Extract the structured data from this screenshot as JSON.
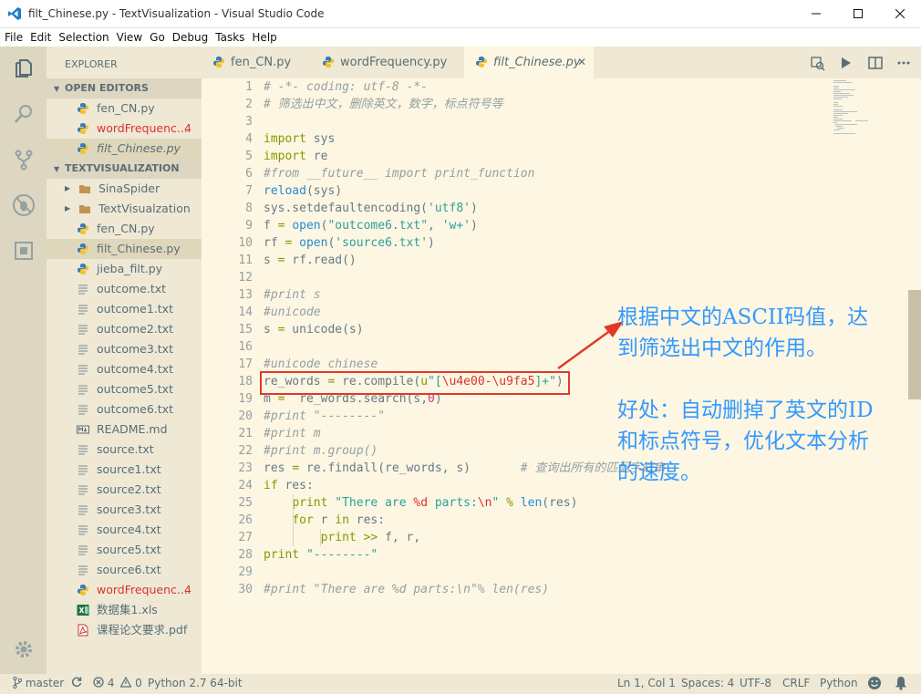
{
  "window": {
    "title": "filt_Chinese.py - TextVisualization - Visual Studio Code"
  },
  "menu": [
    "File",
    "Edit",
    "Selection",
    "View",
    "Go",
    "Debug",
    "Tasks",
    "Help"
  ],
  "sidebar": {
    "title": "EXPLORER",
    "open_editors_header": "OPEN EDITORS",
    "open_editors": [
      {
        "label": "fen_CN.py",
        "icon": "python-icon"
      },
      {
        "label": "wordFrequenc...",
        "badge": "4",
        "icon": "python-icon",
        "color": "#dc322f"
      },
      {
        "label": "filt_Chinese.py",
        "icon": "python-icon",
        "italic": true,
        "selected": true
      }
    ],
    "project_header": "TEXTVISUALIZATION",
    "files": [
      {
        "label": "SinaSpider",
        "icon": "folder-icon",
        "folder": true
      },
      {
        "label": "TextVisualzation",
        "icon": "folder-icon",
        "folder": true
      },
      {
        "label": "fen_CN.py",
        "icon": "python-icon"
      },
      {
        "label": "filt_Chinese.py",
        "icon": "python-icon",
        "selected": true
      },
      {
        "label": "jieba_filt.py",
        "icon": "python-icon"
      },
      {
        "label": "outcome.txt",
        "icon": "text-file-icon"
      },
      {
        "label": "outcome1.txt",
        "icon": "text-file-icon"
      },
      {
        "label": "outcome2.txt",
        "icon": "text-file-icon"
      },
      {
        "label": "outcome3.txt",
        "icon": "text-file-icon"
      },
      {
        "label": "outcome4.txt",
        "icon": "text-file-icon"
      },
      {
        "label": "outcome5.txt",
        "icon": "text-file-icon"
      },
      {
        "label": "outcome6.txt",
        "icon": "text-file-icon"
      },
      {
        "label": "README.md",
        "icon": "markdown-icon"
      },
      {
        "label": "source.txt",
        "icon": "text-file-icon"
      },
      {
        "label": "source1.txt",
        "icon": "text-file-icon"
      },
      {
        "label": "source2.txt",
        "icon": "text-file-icon"
      },
      {
        "label": "source3.txt",
        "icon": "text-file-icon"
      },
      {
        "label": "source4.txt",
        "icon": "text-file-icon"
      },
      {
        "label": "source5.txt",
        "icon": "text-file-icon"
      },
      {
        "label": "source6.txt",
        "icon": "text-file-icon"
      },
      {
        "label": "wordFrequenc...",
        "badge": "4",
        "icon": "python-icon",
        "color": "#dc322f"
      },
      {
        "label": "数据集1.xls",
        "icon": "excel-icon"
      },
      {
        "label": "课程论文要求.pdf",
        "icon": "pdf-icon"
      }
    ]
  },
  "tabs": [
    {
      "label": "fen_CN.py"
    },
    {
      "label": "wordFrequency.py"
    },
    {
      "label": "filt_Chinese.py",
      "active": true
    }
  ],
  "code_lines": [
    "1",
    "2",
    "3",
    "4",
    "5",
    "6",
    "7",
    "8",
    "9",
    "10",
    "11",
    "12",
    "13",
    "14",
    "15",
    "16",
    "17",
    "18",
    "19",
    "20",
    "21",
    "22",
    "23",
    "24",
    "25",
    "26",
    "27",
    "28",
    "29",
    "30"
  ],
  "code": [
    [
      [
        "# -*- coding: utf-8 -*-",
        "com"
      ]
    ],
    [
      [
        "# 筛选出中文，删除英文，数字，标点符号等",
        "com"
      ]
    ],
    [],
    [
      [
        "import",
        "kw"
      ],
      [
        " sys",
        "t"
      ]
    ],
    [
      [
        "import",
        "kw"
      ],
      [
        " re",
        "t"
      ]
    ],
    [
      [
        "#from __future__ import print_function",
        "com"
      ]
    ],
    [
      [
        "reload",
        "fn"
      ],
      [
        "(sys)",
        "t"
      ]
    ],
    [
      [
        "sys.setdefaultencoding(",
        "t"
      ],
      [
        "'utf8'",
        "str"
      ],
      [
        ")",
        "t"
      ]
    ],
    [
      [
        "f ",
        "t"
      ],
      [
        "=",
        "op"
      ],
      [
        " ",
        "t"
      ],
      [
        "open",
        "fn"
      ],
      [
        "(",
        "t"
      ],
      [
        "\"outcome6.txt\"",
        "str"
      ],
      [
        ", ",
        "t"
      ],
      [
        "'w+'",
        "str"
      ],
      [
        ")",
        "t"
      ]
    ],
    [
      [
        "rf ",
        "t"
      ],
      [
        "=",
        "op"
      ],
      [
        " ",
        "t"
      ],
      [
        "open",
        "fn"
      ],
      [
        "(",
        "t"
      ],
      [
        "'source6.txt'",
        "str"
      ],
      [
        ")",
        "t"
      ]
    ],
    [
      [
        "s ",
        "t"
      ],
      [
        "=",
        "op"
      ],
      [
        " rf.read()",
        "t"
      ]
    ],
    [],
    [
      [
        "#print s",
        "com"
      ]
    ],
    [
      [
        "#unicode",
        "com"
      ]
    ],
    [
      [
        "s ",
        "t"
      ],
      [
        "=",
        "op"
      ],
      [
        " unicode(s)",
        "t"
      ]
    ],
    [],
    [
      [
        "#unicode chinese",
        "com"
      ]
    ],
    [
      [
        "re_words ",
        "t"
      ],
      [
        "=",
        "op"
      ],
      [
        " re.compile(",
        "t"
      ],
      [
        "u",
        "kw"
      ],
      [
        "\"[",
        "str"
      ],
      [
        "\\u4e00-\\u9fa5",
        "esc"
      ],
      [
        "]+\"",
        "str"
      ],
      [
        ")",
        "t"
      ]
    ],
    [
      [
        "m ",
        "t"
      ],
      [
        "=",
        "op"
      ],
      [
        "  re_words.search(s,",
        "t"
      ],
      [
        "0",
        "num"
      ],
      [
        ")",
        "t"
      ]
    ],
    [
      [
        "#print \"--------\"",
        "com"
      ]
    ],
    [
      [
        "#print m",
        "com"
      ]
    ],
    [
      [
        "#print m.group()",
        "com"
      ]
    ],
    [
      [
        "res ",
        "t"
      ],
      [
        "=",
        "op"
      ],
      [
        " re.findall(re_words, s)       ",
        "t"
      ],
      [
        "# 查询出所有的匹配字符串",
        "com"
      ]
    ],
    [
      [
        "if",
        "kw"
      ],
      [
        " res:",
        "t"
      ]
    ],
    [
      [
        "    ",
        "t"
      ],
      [
        "print",
        "kw"
      ],
      [
        " ",
        "t"
      ],
      [
        "\"There are ",
        "str"
      ],
      [
        "%d",
        "esc"
      ],
      [
        " parts:",
        "str"
      ],
      [
        "\\n",
        "esc"
      ],
      [
        "\"",
        "str"
      ],
      [
        " ",
        "t"
      ],
      [
        "%",
        "op"
      ],
      [
        " ",
        "t"
      ],
      [
        "len",
        "fn"
      ],
      [
        "(res)",
        "t"
      ]
    ],
    [
      [
        "    ",
        "t"
      ],
      [
        "for",
        "kw"
      ],
      [
        " r ",
        "t"
      ],
      [
        "in",
        "kw"
      ],
      [
        " res:",
        "t"
      ]
    ],
    [
      [
        "        ",
        "t"
      ],
      [
        "print",
        "kw"
      ],
      [
        " ",
        "t"
      ],
      [
        ">>",
        "op"
      ],
      [
        " f, r,",
        "t"
      ]
    ],
    [
      [
        "print",
        "kw"
      ],
      [
        " ",
        "t"
      ],
      [
        "\"--------\"",
        "str"
      ]
    ],
    [],
    [
      [
        "#print \"There are %d parts:\\n\"% len(res)",
        "com"
      ]
    ]
  ],
  "annotation": {
    "line1": "根据中文的ASCII码值，达",
    "line2": "到筛选出中文的作用。",
    "line3": "好处：自动删掉了英文的ID",
    "line4": "和标点符号，优化文本分析",
    "line5": "的速度。"
  },
  "status": {
    "branch": "master",
    "errors": "4",
    "warnings": "0",
    "interpreter": "Python 2.7 64-bit",
    "cursor": "Ln 1, Col 1",
    "spaces": "Spaces: 4",
    "encoding": "UTF-8",
    "eol": "CRLF",
    "language": "Python"
  },
  "colors": {
    "keyword": "#859900",
    "string": "#2aa198",
    "comment": "#93a1a1",
    "function": "#268bd2",
    "escape": "#dc322f",
    "number": "#d33682",
    "annotation": "#3399ff",
    "highlight_box": "#e0392b"
  }
}
